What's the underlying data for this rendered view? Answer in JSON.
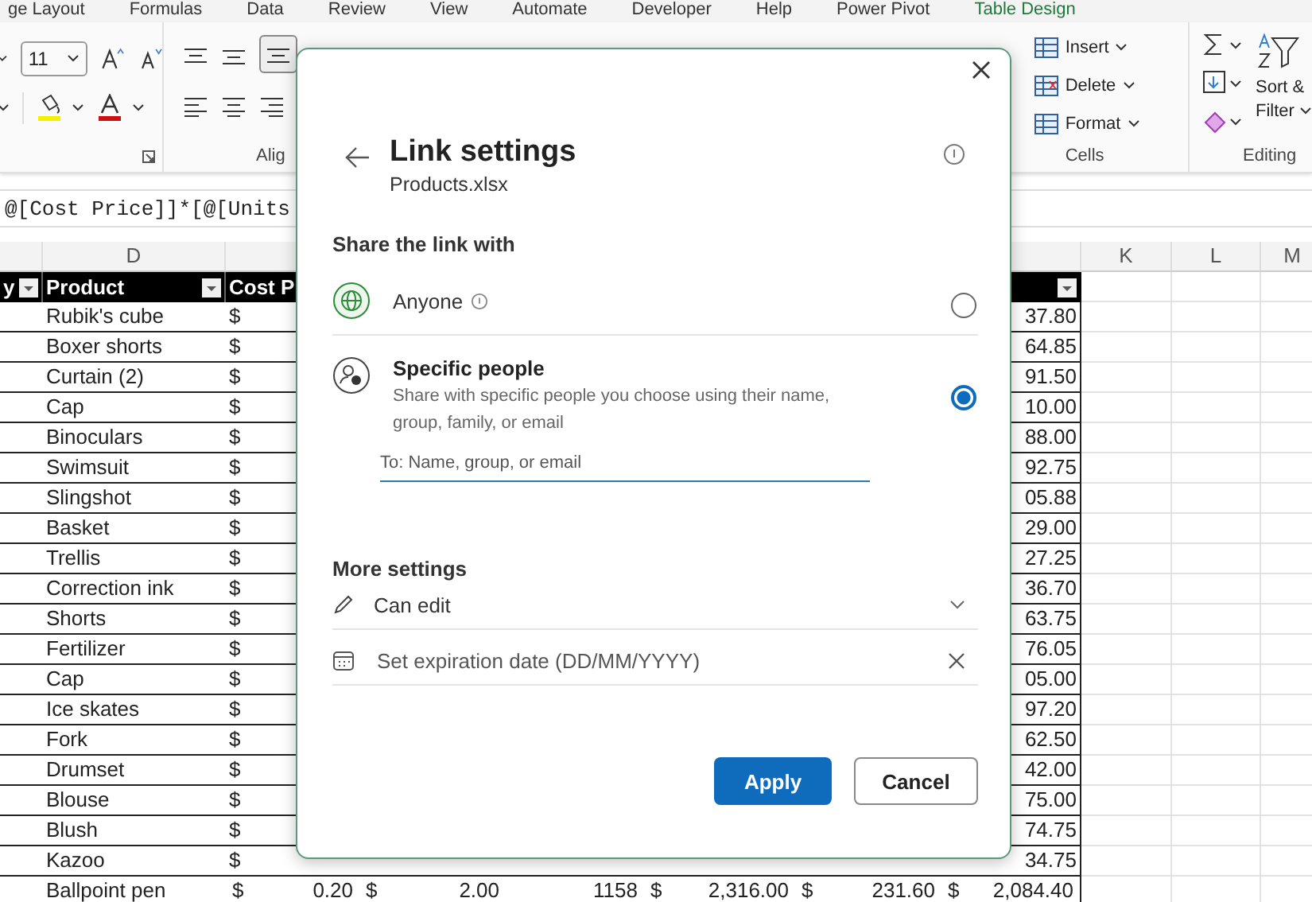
{
  "ribbon_tabs": [
    {
      "label": "ge Layout",
      "selected": false
    },
    {
      "label": "Formulas",
      "selected": false
    },
    {
      "label": "Data",
      "selected": false
    },
    {
      "label": "Review",
      "selected": false
    },
    {
      "label": "View",
      "selected": false
    },
    {
      "label": "Automate",
      "selected": false
    },
    {
      "label": "Developer",
      "selected": false
    },
    {
      "label": "Help",
      "selected": false
    },
    {
      "label": "Power Pivot",
      "selected": false
    },
    {
      "label": "Table Design",
      "selected": true
    }
  ],
  "ribbon": {
    "font_size": "11",
    "alignment_label": "Alig",
    "cells_commands": [
      "Insert",
      "Delete",
      "Format"
    ],
    "cells_label": "Cells",
    "sort_label": "Sort &",
    "filter_label": "Filter",
    "editing_label": "Editing"
  },
  "formula_bar": {
    "formula": "@[Cost Price]]*[@[Units"
  },
  "column_headers": [
    "D",
    "K",
    "L",
    "M"
  ],
  "table": {
    "headers": [
      "y",
      "Product",
      "Cost P"
    ],
    "rows": [
      {
        "product": "Rubik's cube",
        "cost": "$",
        "column_j": "37.80"
      },
      {
        "product": "Boxer shorts",
        "cost": "$",
        "column_j": "64.85"
      },
      {
        "product": "Curtain (2)",
        "cost": "$",
        "column_j": "91.50"
      },
      {
        "product": "Cap",
        "cost": "$",
        "column_j": "10.00"
      },
      {
        "product": "Binoculars",
        "cost": "$",
        "column_j": "88.00"
      },
      {
        "product": "Swimsuit",
        "cost": "$",
        "column_j": "92.75"
      },
      {
        "product": "Slingshot",
        "cost": "$",
        "column_j": "05.88"
      },
      {
        "product": "Basket",
        "cost": "$",
        "column_j": "29.00"
      },
      {
        "product": "Trellis",
        "cost": "$",
        "column_j": "27.25"
      },
      {
        "product": "Correction ink",
        "cost": "$",
        "column_j": "36.70"
      },
      {
        "product": "Shorts",
        "cost": "$",
        "column_j": "63.75"
      },
      {
        "product": "Fertilizer",
        "cost": "$",
        "column_j": "76.05"
      },
      {
        "product": "Cap",
        "cost": "$",
        "column_j": "05.00"
      },
      {
        "product": "Ice skates",
        "cost": "$",
        "column_j": "97.20"
      },
      {
        "product": "Fork",
        "cost": "$",
        "column_j": "62.50"
      },
      {
        "product": "Drumset",
        "cost": "$",
        "column_j": "42.00"
      },
      {
        "product": "Blouse",
        "cost": "$",
        "column_j": "75.00"
      },
      {
        "product": "Blush",
        "cost": "$",
        "column_j": "74.75"
      },
      {
        "product": "Kazoo",
        "cost": "$",
        "column_j": "34.75"
      }
    ],
    "bottom_row": {
      "product": "Ballpoint pen",
      "cells": [
        {
          "currency": "$",
          "value": "0.20"
        },
        {
          "currency": "$",
          "value": "2.00"
        },
        {
          "value": "1158"
        },
        {
          "currency": "$",
          "value": "2,316.00"
        },
        {
          "currency": "$",
          "value": "231.60"
        },
        {
          "currency": "$",
          "value": "2,084.40"
        }
      ]
    }
  },
  "dialog": {
    "title": "Link settings",
    "file": "Products.xlsx",
    "share_heading": "Share the link with",
    "options": [
      {
        "kind": "globe",
        "label": "Anyone",
        "info": true,
        "selected": false
      },
      {
        "kind": "people",
        "label": "Specific people",
        "info": false,
        "description": "Share with specific people you choose using their name, group, family, or email",
        "selected": true,
        "recipient_placeholder": "To: Name, group, or email"
      }
    ],
    "more_heading": "More settings",
    "permission": "Can edit",
    "expiration_placeholder": "Set expiration date (DD/MM/YYYY)",
    "buttons": [
      {
        "label": "Apply",
        "primary": true
      },
      {
        "label": "Cancel",
        "primary": false
      }
    ]
  }
}
